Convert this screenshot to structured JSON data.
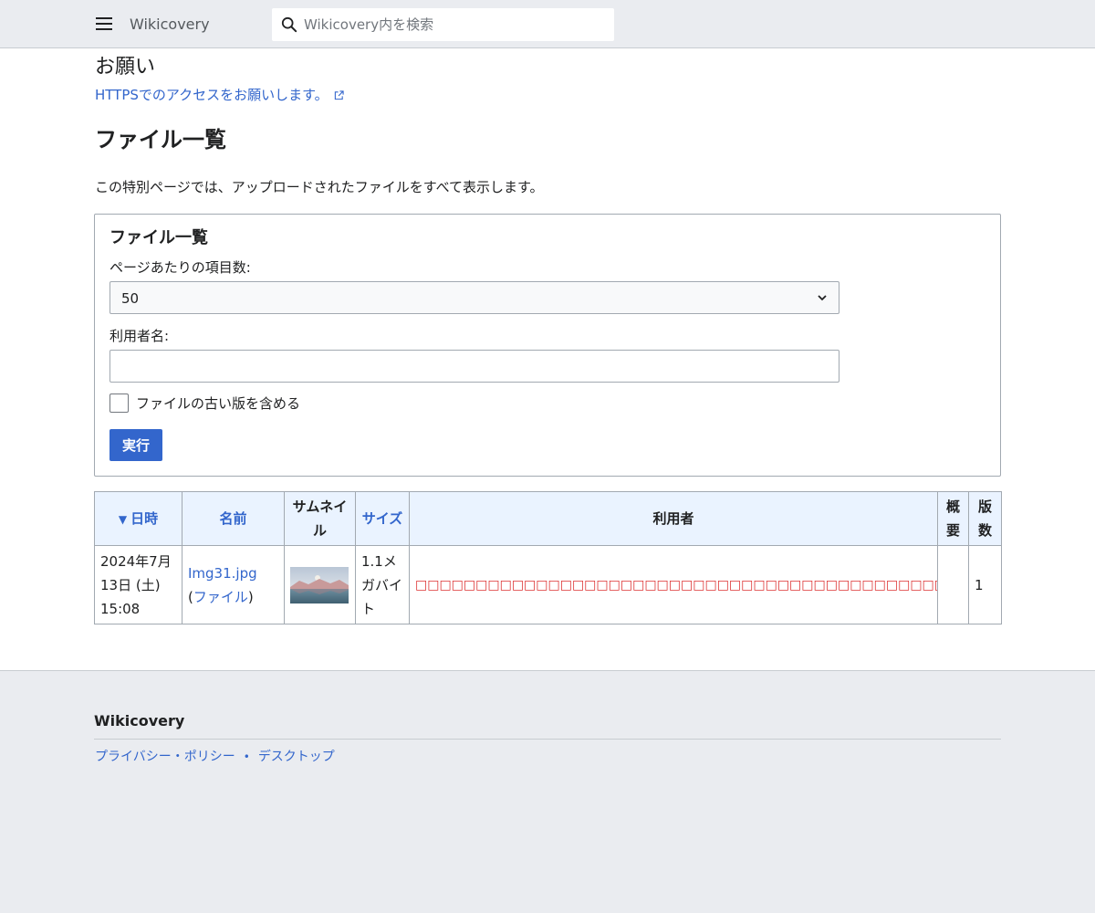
{
  "header": {
    "site_title": "Wikicovery",
    "search_placeholder": "Wikicovery内を検索"
  },
  "sitenotice": {
    "title": "お願い",
    "link_text": "HTTPSでのアクセスをお願いします。"
  },
  "page": {
    "title": "ファイル一覧",
    "intro": "この特別ページでは、アップロードされたファイルをすべて表示します。"
  },
  "form": {
    "legend": "ファイル一覧",
    "limit_label": "ページあたりの項目数:",
    "limit_value": "50",
    "user_label": "利用者名:",
    "user_value": "",
    "old_versions_label": "ファイルの古い版を含める",
    "submit_label": "実行"
  },
  "table": {
    "headers": {
      "date": "日時",
      "name": "名前",
      "thumbnail": "サムネイル",
      "size": "サイズ",
      "user": "利用者",
      "description": "概要",
      "versions": "版数"
    },
    "sort_indicator": "▼",
    "rows": [
      {
        "date": "2024年7月13日 (土) 15:08",
        "name": "Img31.jpg",
        "file_link_open": "(",
        "file_link": "ファイル",
        "file_link_close": ")",
        "size": "1.1メガバイト",
        "user": "□□□□□□□□□□□□□□□□□□□□□□□□□□□□□□□□□□□□□□□□□□□□□□□□□□□□□□□□°",
        "description": "",
        "versions": "1"
      }
    ]
  },
  "footer": {
    "title": "Wikicovery",
    "links": [
      "プライバシー・ポリシー",
      "デスクトップ"
    ],
    "separator": "•"
  },
  "colors": {
    "link": "#3366cc",
    "header_bg": "#eaecf0",
    "table_header_bg": "#eaf3ff",
    "error_red": "#d33",
    "primary_button": "#3366cc"
  },
  "icons": {
    "menu": "menu-icon",
    "search": "search-icon",
    "external": "external-link-icon",
    "dropdown": "chevron-down-icon"
  }
}
